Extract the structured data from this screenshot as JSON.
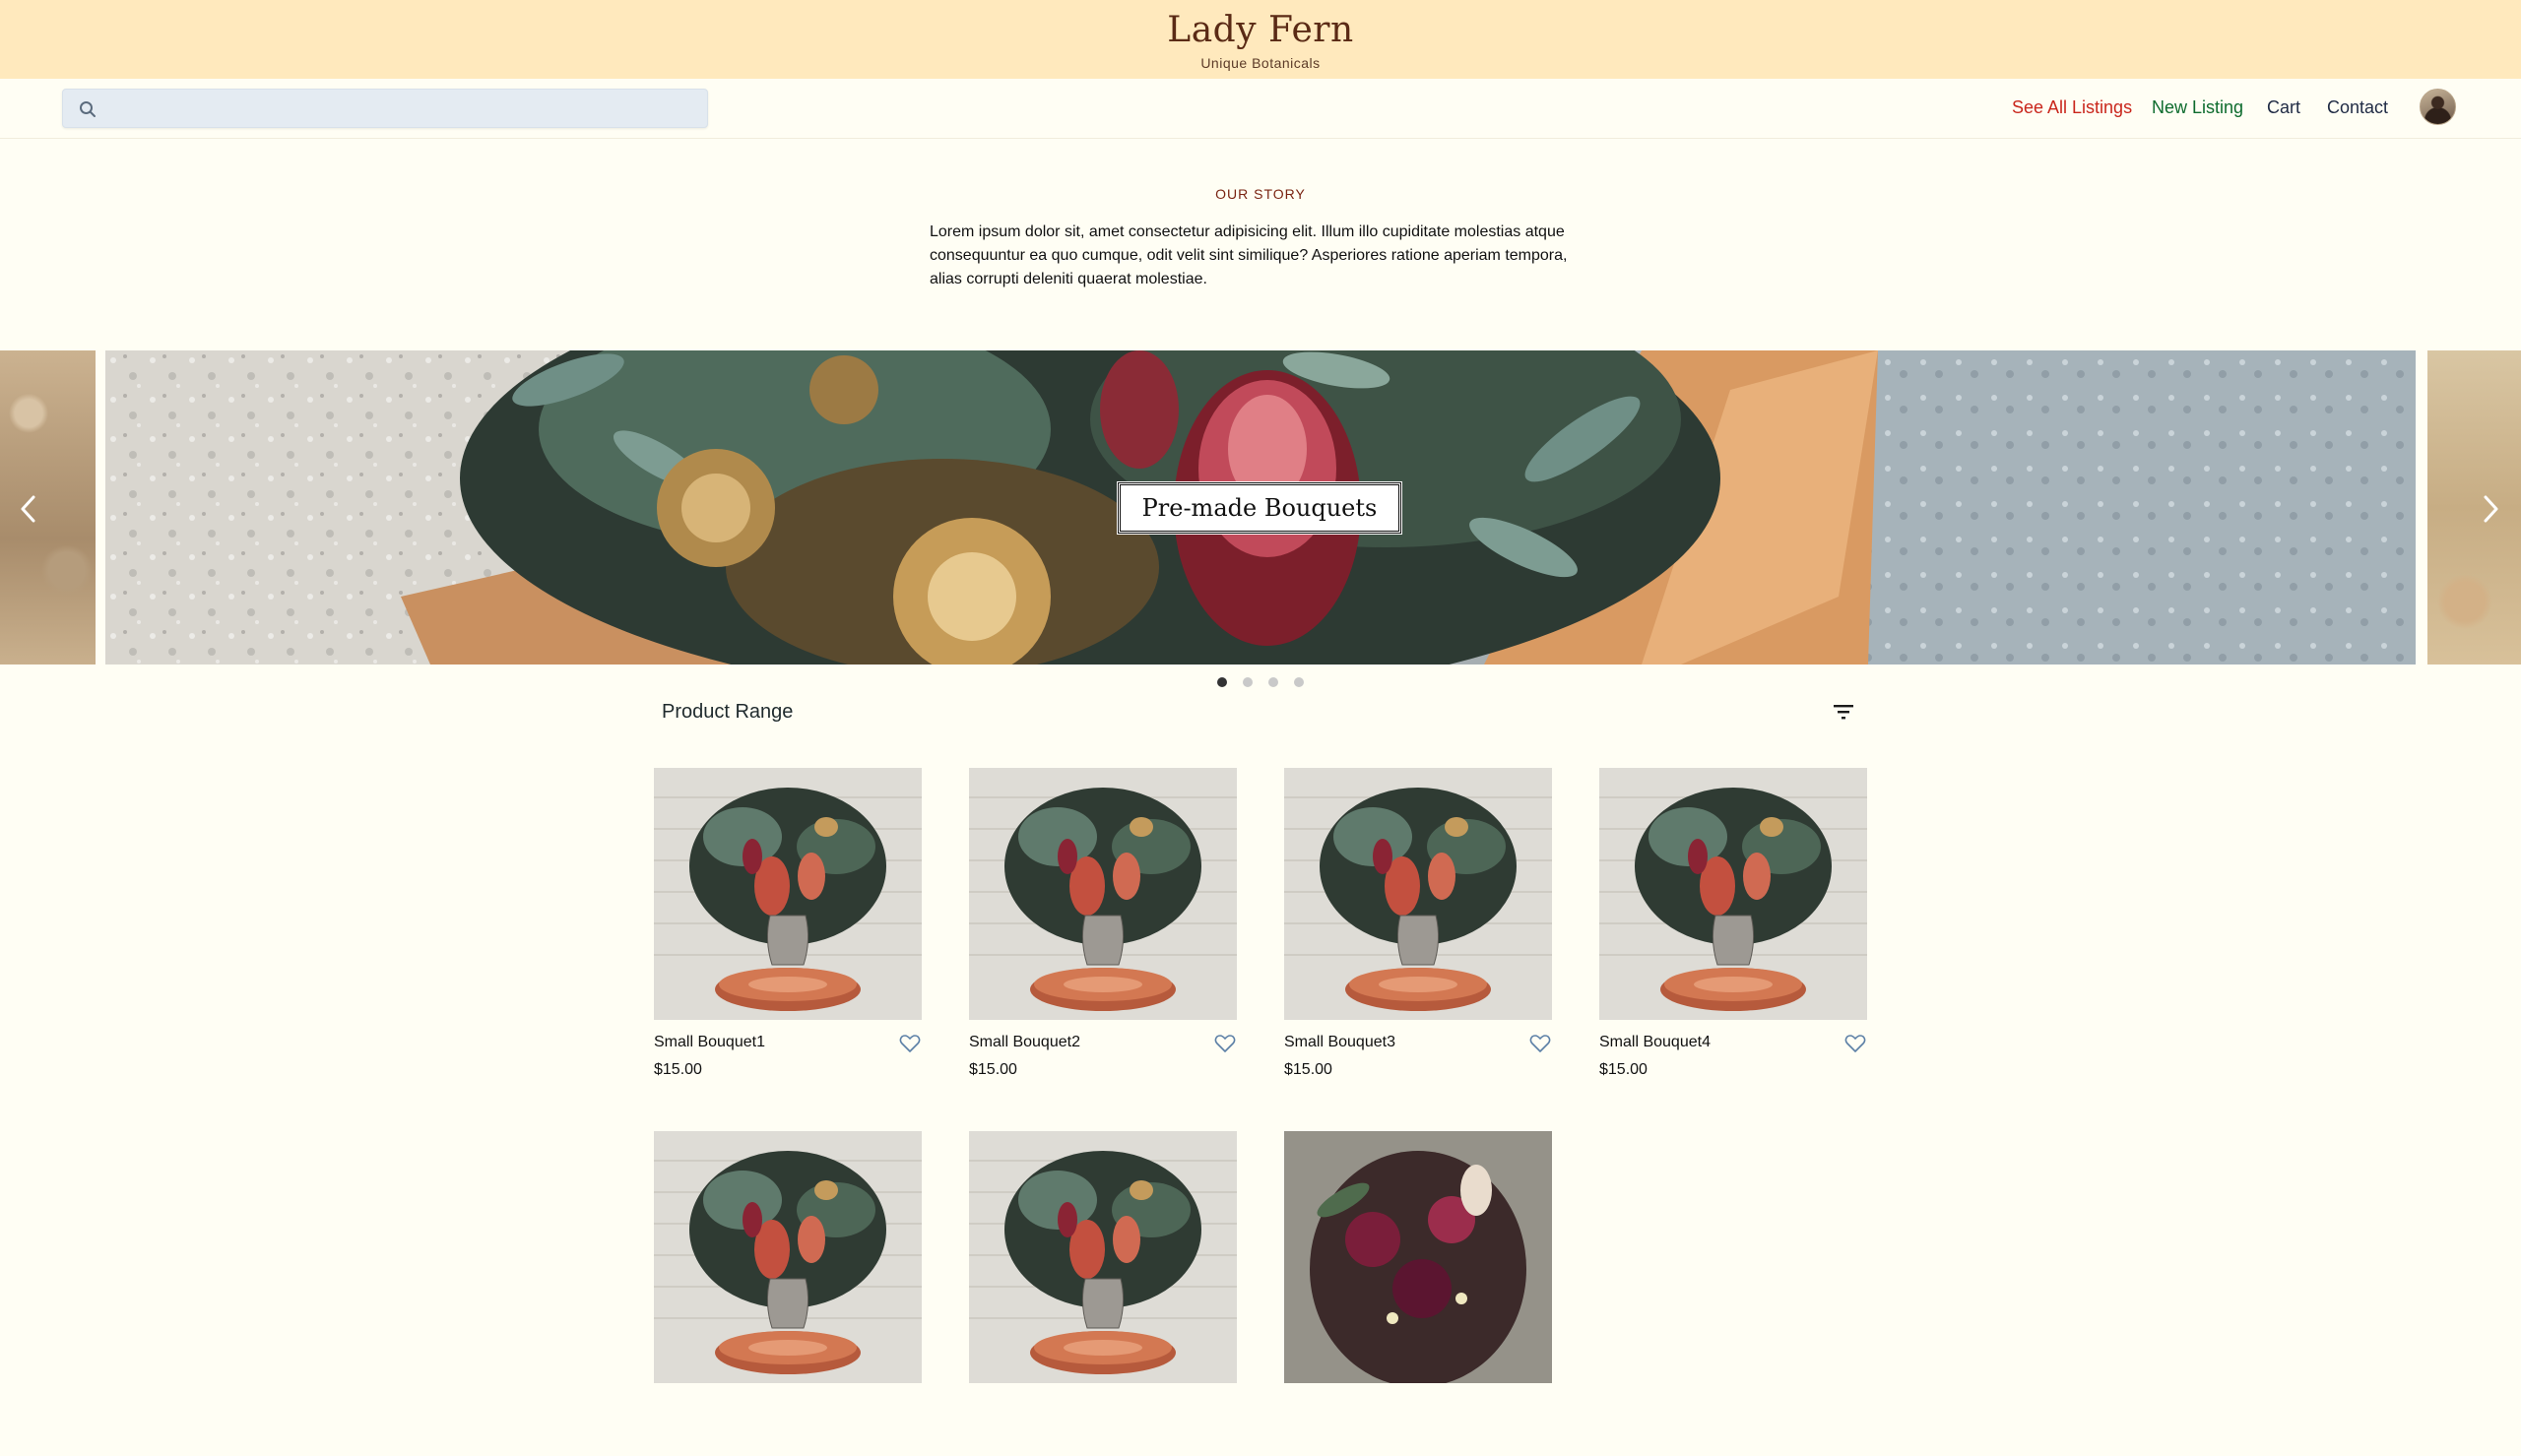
{
  "brand": {
    "title": "Lady Fern",
    "subtitle": "Unique Botanicals"
  },
  "nav": {
    "search": {
      "placeholder": "",
      "value": "",
      "icon": "search-icon"
    },
    "links": [
      {
        "label": "See All Listings",
        "color": "#c9261c"
      },
      {
        "label": "New Listing",
        "color": "#0d6b2d"
      },
      {
        "label": "Cart",
        "color": "#1f2a44"
      },
      {
        "label": "Contact",
        "color": "#1f2a44"
      }
    ],
    "avatar_icon": "avatar"
  },
  "story": {
    "heading": "OUR STORY",
    "body": "Lorem ipsum dolor sit, amet consectetur adipisicing elit. Illum illo cupiditate molestias atque consequuntur ea quo cumque, odit velit sint similique? Asperiores ratione aperiam tempora, alias corrupti deleniti quaerat molestiae."
  },
  "carousel": {
    "caption": "Pre-made Bouquets",
    "slide_count": 4,
    "active_index": 0,
    "prev_icon": "chevron-left-icon",
    "next_icon": "chevron-right-icon"
  },
  "products": {
    "title": "Product Range",
    "filter_icon": "filter-icon",
    "items": [
      {
        "name": "Small Bouquet1",
        "price": "$15.00",
        "image": "vase-bouquet"
      },
      {
        "name": "Small Bouquet2",
        "price": "$15.00",
        "image": "vase-bouquet"
      },
      {
        "name": "Small Bouquet3",
        "price": "$15.00",
        "image": "vase-bouquet"
      },
      {
        "name": "Small Bouquet4",
        "price": "$15.00",
        "image": "vase-bouquet"
      },
      {
        "name": "",
        "price": "",
        "image": "vase-bouquet"
      },
      {
        "name": "",
        "price": "",
        "image": "vase-bouquet"
      },
      {
        "name": "",
        "price": "",
        "image": "dark-bouquet"
      }
    ]
  },
  "colors": {
    "banner": "#ffe9bd",
    "page": "#fffef4",
    "accent_red": "#c9261c",
    "accent_green": "#0d6b2d",
    "heart": "#5b7fa6"
  }
}
